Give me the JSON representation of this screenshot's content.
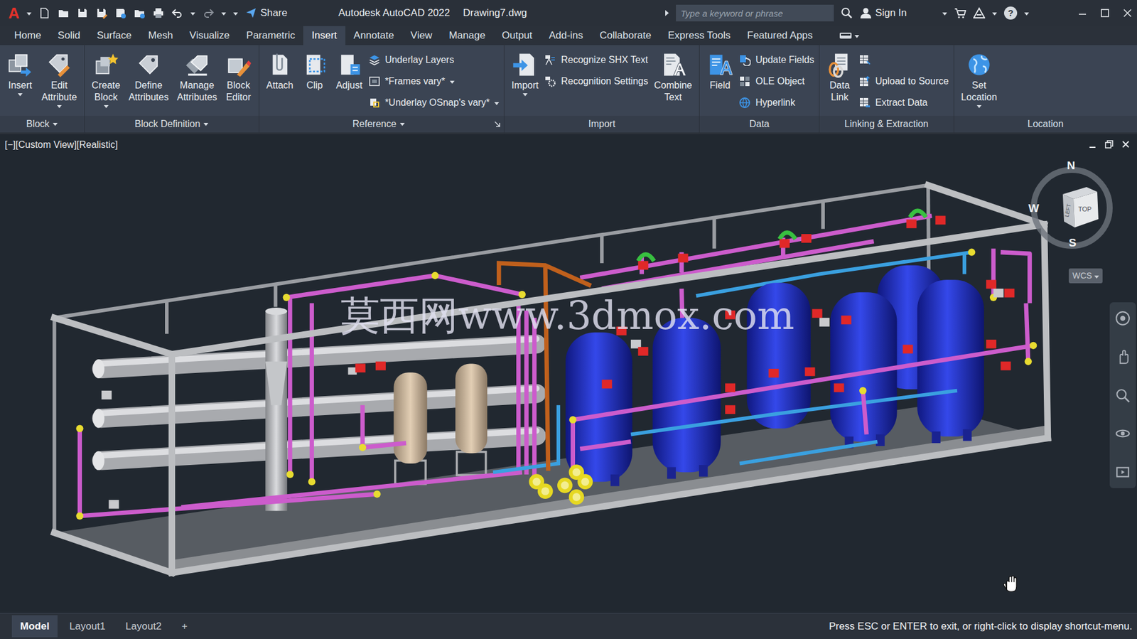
{
  "titlebar": {
    "logo": "A",
    "title": "Autodesk AutoCAD 2022",
    "file": "Drawing7.dwg",
    "share": "Share",
    "search_placeholder": "Type a keyword or phrase",
    "sign_in": "Sign In",
    "help": "?"
  },
  "ribbon_tabs": [
    {
      "label": "Home",
      "selected": false
    },
    {
      "label": "Solid",
      "selected": false
    },
    {
      "label": "Surface",
      "selected": false
    },
    {
      "label": "Mesh",
      "selected": false
    },
    {
      "label": "Visualize",
      "selected": false
    },
    {
      "label": "Parametric",
      "selected": false
    },
    {
      "label": "Insert",
      "selected": true
    },
    {
      "label": "Annotate",
      "selected": false
    },
    {
      "label": "View",
      "selected": false
    },
    {
      "label": "Manage",
      "selected": false
    },
    {
      "label": "Output",
      "selected": false
    },
    {
      "label": "Add-ins",
      "selected": false
    },
    {
      "label": "Collaborate",
      "selected": false
    },
    {
      "label": "Express Tools",
      "selected": false
    },
    {
      "label": "Featured Apps",
      "selected": false
    }
  ],
  "ribbon_panels": [
    {
      "label": "Block",
      "menu": true,
      "launcher": false,
      "items": [
        {
          "kind": "large",
          "lines": [
            "Insert"
          ],
          "dropdown": true
        },
        {
          "kind": "large",
          "lines": [
            "Edit",
            "Attribute"
          ],
          "dropdown": true
        }
      ]
    },
    {
      "label": "Block Definition",
      "menu": true,
      "launcher": false,
      "items": [
        {
          "kind": "large",
          "lines": [
            "Create",
            "Block"
          ],
          "dropdown": true
        },
        {
          "kind": "large",
          "lines": [
            "Define",
            "Attributes"
          ],
          "dropdown": false
        },
        {
          "kind": "large",
          "lines": [
            "Manage",
            "Attributes"
          ],
          "dropdown": false
        },
        {
          "kind": "large",
          "lines": [
            "Block",
            "Editor"
          ],
          "dropdown": false
        }
      ]
    },
    {
      "label": "Reference",
      "menu": true,
      "launcher": true,
      "items": [
        {
          "kind": "large",
          "lines": [
            "Attach"
          ],
          "dropdown": false
        },
        {
          "kind": "large",
          "lines": [
            "Clip"
          ],
          "dropdown": false
        },
        {
          "kind": "large",
          "lines": [
            "Adjust"
          ],
          "dropdown": false
        },
        {
          "kind": "stack",
          "items": [
            {
              "kind": "labeled",
              "label": "Underlay Layers",
              "dropdown": false
            },
            {
              "kind": "labeled",
              "label": "*Frames vary*",
              "dropdown": true
            },
            {
              "kind": "labeled",
              "label": "*Underlay OSnap's vary*",
              "dropdown": true
            }
          ]
        }
      ]
    },
    {
      "label": "Import",
      "menu": false,
      "launcher": false,
      "items": [
        {
          "kind": "large",
          "lines": [
            "Import"
          ],
          "dropdown": true
        },
        {
          "kind": "stack",
          "items": [
            {
              "kind": "labeled",
              "label": "Recognize SHX Text",
              "dropdown": false
            },
            {
              "kind": "labeled",
              "label": "Recognition Settings",
              "dropdown": false
            }
          ]
        },
        {
          "kind": "large",
          "lines": [
            "Combine",
            "Text"
          ],
          "dropdown": false
        }
      ]
    },
    {
      "label": "Data",
      "menu": false,
      "launcher": false,
      "items": [
        {
          "kind": "large",
          "lines": [
            "Field"
          ],
          "dropdown": false
        },
        {
          "kind": "stack",
          "items": [
            {
              "kind": "labeled",
              "label": "Update Fields",
              "dropdown": false
            },
            {
              "kind": "labeled",
              "label": "OLE Object",
              "dropdown": false
            },
            {
              "kind": "labeled",
              "label": "Hyperlink",
              "dropdown": false
            }
          ]
        }
      ]
    },
    {
      "label": "Linking & Extraction",
      "menu": false,
      "launcher": false,
      "items": [
        {
          "kind": "large",
          "lines": [
            "Data",
            "Link"
          ],
          "dropdown": false
        },
        {
          "kind": "stack",
          "items": [
            {
              "kind": "icon",
              "dropdown": false
            },
            {
              "kind": "labeled",
              "label": "Upload to Source",
              "dropdown": false
            },
            {
              "kind": "labeled",
              "label": "Extract Data",
              "dropdown": false
            }
          ]
        }
      ]
    },
    {
      "label": "Location",
      "menu": false,
      "launcher": false,
      "items": [
        {
          "kind": "large",
          "lines": [
            "Set",
            "Location"
          ],
          "dropdown": true
        }
      ]
    }
  ],
  "viewport": {
    "label": "[−][Custom View][Realistic]",
    "watermark": "莫西网www.3dmox.com",
    "compass": {
      "north": "N",
      "west": "W",
      "south": "S"
    },
    "viewcube": {
      "top": "TOP",
      "left": "LEFT"
    },
    "ucs": "WCS"
  },
  "layout_tabs": [
    {
      "label": "Model",
      "selected": true
    },
    {
      "label": "Layout1",
      "selected": false
    },
    {
      "label": "Layout2",
      "selected": false
    },
    {
      "label": "+",
      "selected": false
    }
  ],
  "command_prompt": "Press ESC or ENTER to exit, or right-click to display shortcut-menu."
}
